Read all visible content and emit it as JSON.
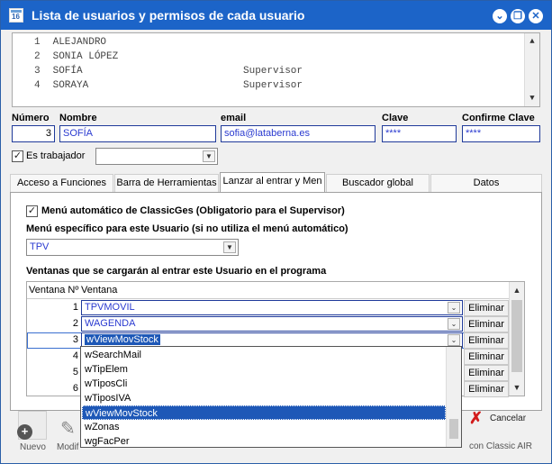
{
  "window": {
    "title": "Lista de usuarios y permisos de cada usuario",
    "app_icon": "calendar-16-icon",
    "controls": {
      "menu": "⌄",
      "restore": "❐",
      "close": "✕"
    }
  },
  "user_list": {
    "rows": [
      {
        "num": "1",
        "name": "ALEJANDRO",
        "role": ""
      },
      {
        "num": "2",
        "name": "SONIA LÓPEZ",
        "role": ""
      },
      {
        "num": "3",
        "name": "SOFÍA",
        "role": "Supervisor"
      },
      {
        "num": "4",
        "name": "SORAYA",
        "role": "Supervisor"
      }
    ]
  },
  "form": {
    "numero_label": "Número",
    "numero_value": "3",
    "nombre_label": "Nombre",
    "nombre_value": "SOFÍA",
    "email_label": "email",
    "email_value": "sofia@lataberna.es",
    "clave_label": "Clave",
    "clave_value": "****",
    "confirme_label": "Confirme Clave",
    "confirme_value": "****",
    "trabajador_label": "Es trabajador",
    "trabajador_checked": true
  },
  "tabs": [
    {
      "label": "Acceso a Funciones"
    },
    {
      "label": "Barra de Herramientas"
    },
    {
      "label": "Lanzar al entrar y Men"
    },
    {
      "label": "Buscador global"
    },
    {
      "label": "Datos"
    }
  ],
  "active_tab_index": 2,
  "panel": {
    "auto_menu_label": "Menú automático de ClassicGes (Obligatorio para el Supervisor)",
    "auto_menu_checked": true,
    "specific_menu_label": "Menú específico para este Usuario (si no utiliza el menú automático)",
    "specific_menu_value": "TPV",
    "windows_label": "Ventanas que se cargarán al entrar este Usuario en el programa"
  },
  "grid": {
    "col_num": "Ventana Nº",
    "col_window": "Ventana",
    "eliminar_label": "Eliminar",
    "rows": [
      {
        "num": "1",
        "window": "TPVMOVIL"
      },
      {
        "num": "2",
        "window": "WAGENDA"
      },
      {
        "num": "3",
        "window": "wViewMovStock"
      },
      {
        "num": "4",
        "window": ""
      },
      {
        "num": "5",
        "window": ""
      },
      {
        "num": "6",
        "window": ""
      }
    ]
  },
  "dropdown": {
    "options": [
      "wSearchMail",
      "wTipElem",
      "wTiposCli",
      "wTiposIVA",
      "wViewMovStock",
      "wZonas",
      "wgFacPer"
    ],
    "selected": "wViewMovStock"
  },
  "bottom": {
    "nuevo_label": "Nuevo",
    "modif_label": "Modif",
    "cancelar_label": "Cancelar",
    "classic_air_text": "con Classic AIR"
  }
}
